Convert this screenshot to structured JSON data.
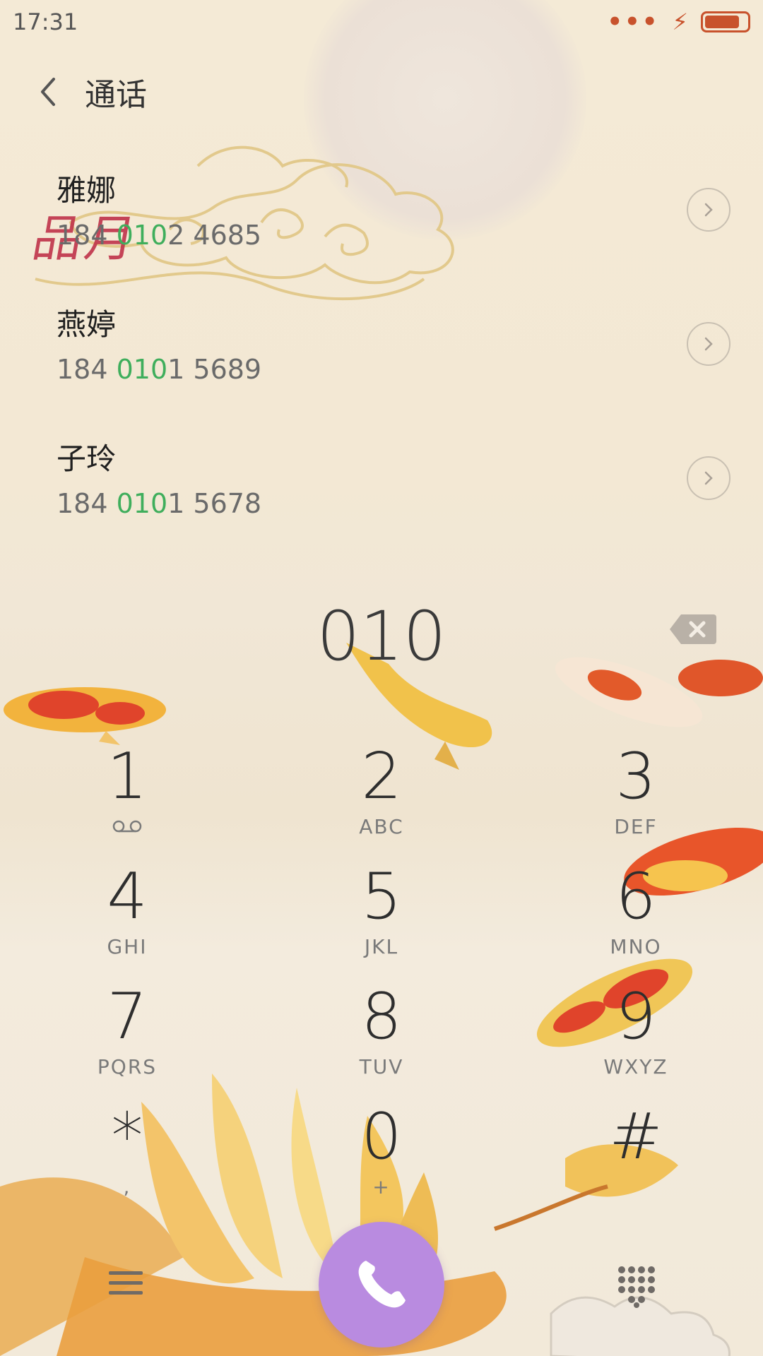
{
  "status_bar": {
    "time": "17:31"
  },
  "header": {
    "title": "通话"
  },
  "contacts": [
    {
      "name": "雅娜",
      "number_prefix": "184 ",
      "number_match": "010",
      "number_suffix": "2 4685"
    },
    {
      "name": "燕婷",
      "number_prefix": "184 ",
      "number_match": "010",
      "number_suffix": "1 5689"
    },
    {
      "name": "子玲",
      "number_prefix": "184 ",
      "number_match": "010",
      "number_suffix": "1 5678"
    }
  ],
  "dialer": {
    "input": "010"
  },
  "keypad": {
    "keys": [
      {
        "digit": "1",
        "letters": ""
      },
      {
        "digit": "2",
        "letters": "ABC"
      },
      {
        "digit": "3",
        "letters": "DEF"
      },
      {
        "digit": "4",
        "letters": "GHI"
      },
      {
        "digit": "5",
        "letters": "JKL"
      },
      {
        "digit": "6",
        "letters": "MNO"
      },
      {
        "digit": "7",
        "letters": "PQRS"
      },
      {
        "digit": "8",
        "letters": "TUV"
      },
      {
        "digit": "9",
        "letters": "WXYZ"
      },
      {
        "digit": "*",
        "letters": ","
      },
      {
        "digit": "0",
        "letters": "+"
      },
      {
        "digit": "#",
        "letters": ""
      }
    ]
  },
  "decor": {
    "watermark_text": "品月"
  },
  "colors": {
    "accent_call": "#b98be0",
    "match_highlight": "#3fae5c",
    "status_accent": "#c8522c"
  }
}
